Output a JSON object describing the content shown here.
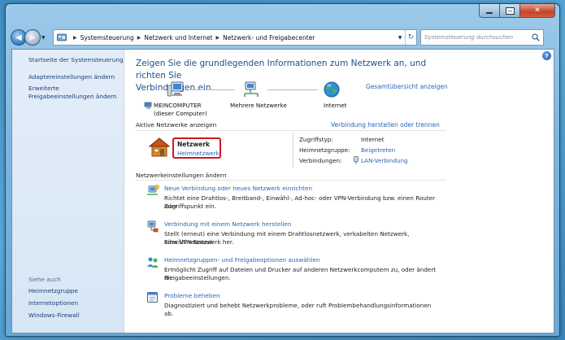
{
  "address": {
    "crumbs": [
      "Systemsteuerung",
      "Netzwerk und Internet",
      "Netzwerk- und Freigabecenter"
    ],
    "search_placeholder": "Systemsteuerung durchsuchen"
  },
  "sidebar": {
    "links": [
      "Startseite der Systemsteuerung",
      "Adaptereinstellungen ändern",
      "Erweiterte",
      "Freigabeeinstellungen ändern"
    ],
    "see_also_heading": "Siehe auch",
    "see_also": [
      "Heimnetzgruppe",
      "Internetoptionen",
      "Windows-Firewall"
    ]
  },
  "main": {
    "title_line1": "Zeigen Sie die grundlegenden Informationen zum Netzwerk an, und richten Sie",
    "title_line2": "Verbindungen ein.",
    "full_map_link": "Gesamtübersicht anzeigen",
    "nodes": {
      "computer_name": "MEINCOMPUTER",
      "computer_sub": "(dieser Computer)",
      "multiple": "Mehrere Netzwerke",
      "internet": "Internet"
    },
    "active_title": "Aktive Netzwerke anzeigen",
    "connect_disconnect_link": "Verbindung herstellen oder trennen",
    "network": {
      "name": "Netzwerk",
      "type": "Heimnetzwerk"
    },
    "details": {
      "access_label": "Zugriffstyp:",
      "access_value": "Internet",
      "homegroup_label": "Heimnetzgruppe:",
      "homegroup_value": "Beigetreten",
      "connections_label": "Verbindungen:",
      "connections_value": "LAN-Verbindung"
    },
    "settings_title": "Netzwerkeinstellungen ändern",
    "tasks": [
      {
        "link": "Neue Verbindung oder neues Netzwerk einrichten",
        "desc1": "Richtet eine Drahtlos-, Breitband-, Einwähl-, Ad-hoc- oder VPN-Verbindung bzw. einen Router oder",
        "desc2": "Zugriffspunkt ein."
      },
      {
        "link": "Verbindung mit einem Netzwerk herstellen",
        "desc1": "Stellt (erneut) eine Verbindung mit einem Drahtlosnetzwerk, verkabelten Netzwerk, Einwählnetzwerk",
        "desc2": "oder VPN-Netzwerk her."
      },
      {
        "link": "Heimnetzgruppen- und Freigabeoptionen auswählen",
        "desc1": "Ermöglicht Zugriff auf Dateien und Drucker auf anderen Netzwerkcomputern zu, oder ändert die",
        "desc2": "Freigabeeinstellungen."
      },
      {
        "link": "Probleme beheben",
        "desc1": "Diagnostiziert und behebt Netzwerkprobleme, oder ruft Problembehandlungsinformationen ab."
      }
    ]
  }
}
